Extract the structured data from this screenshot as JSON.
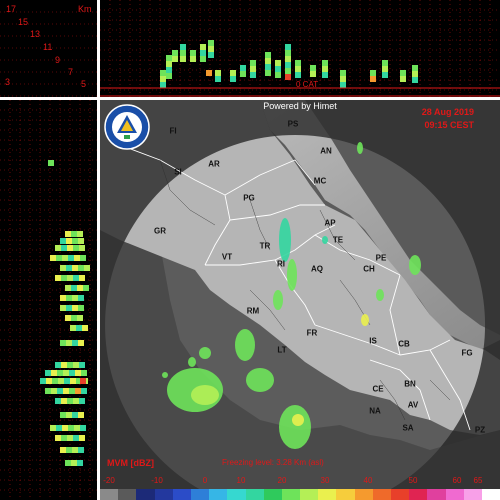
{
  "header": {
    "powered_by": "Powered by Himet",
    "date": "28 Aug 2019",
    "time": "09:15 CEST"
  },
  "product": {
    "name": "MVM [dBZ]",
    "freezing_level": "Freezing level: 3.28 Km (asl)",
    "cat_label": "0 CAT"
  },
  "height_scale": {
    "unit": "Km",
    "ticks": [
      "17",
      "15",
      "13",
      "11",
      "9",
      "7",
      "5",
      "3"
    ]
  },
  "legend": {
    "ticks": [
      "-20",
      "-10",
      "0",
      "10",
      "20",
      "30",
      "40",
      "50",
      "60",
      "65"
    ],
    "colors": [
      "#8a8a8a",
      "#5a5a5a",
      "#1c2a78",
      "#23389e",
      "#2b4cc8",
      "#2e7fd8",
      "#36b6e6",
      "#36d8d0",
      "#33d6a0",
      "#2fca5c",
      "#6ee35a",
      "#b4ef56",
      "#eaf04e",
      "#f6cd3c",
      "#f59a2e",
      "#ef6a2a",
      "#e8402a",
      "#e02452",
      "#e0409e",
      "#f06ad0",
      "#f8a0e8",
      "#ffffff"
    ]
  },
  "places": [
    {
      "code": "FI"
    },
    {
      "code": "PS"
    },
    {
      "code": "AN"
    },
    {
      "code": "AR"
    },
    {
      "code": "SI"
    },
    {
      "code": "MC"
    },
    {
      "code": "PG"
    },
    {
      "code": "AP"
    },
    {
      "code": "GR"
    },
    {
      "code": "TE"
    },
    {
      "code": "TR"
    },
    {
      "code": "VT"
    },
    {
      "code": "RI"
    },
    {
      "code": "AQ"
    },
    {
      "code": "PE"
    },
    {
      "code": "CH"
    },
    {
      "code": "RM"
    },
    {
      "code": "FR"
    },
    {
      "code": "IS"
    },
    {
      "code": "CB"
    },
    {
      "code": "FG"
    },
    {
      "code": "LT"
    },
    {
      "code": "CE"
    },
    {
      "code": "BN"
    },
    {
      "code": "AV"
    },
    {
      "code": "NA"
    },
    {
      "code": "SA"
    },
    {
      "code": "PZ"
    }
  ],
  "logo": {
    "caption": "PROTEZIONE CIVILE"
  }
}
